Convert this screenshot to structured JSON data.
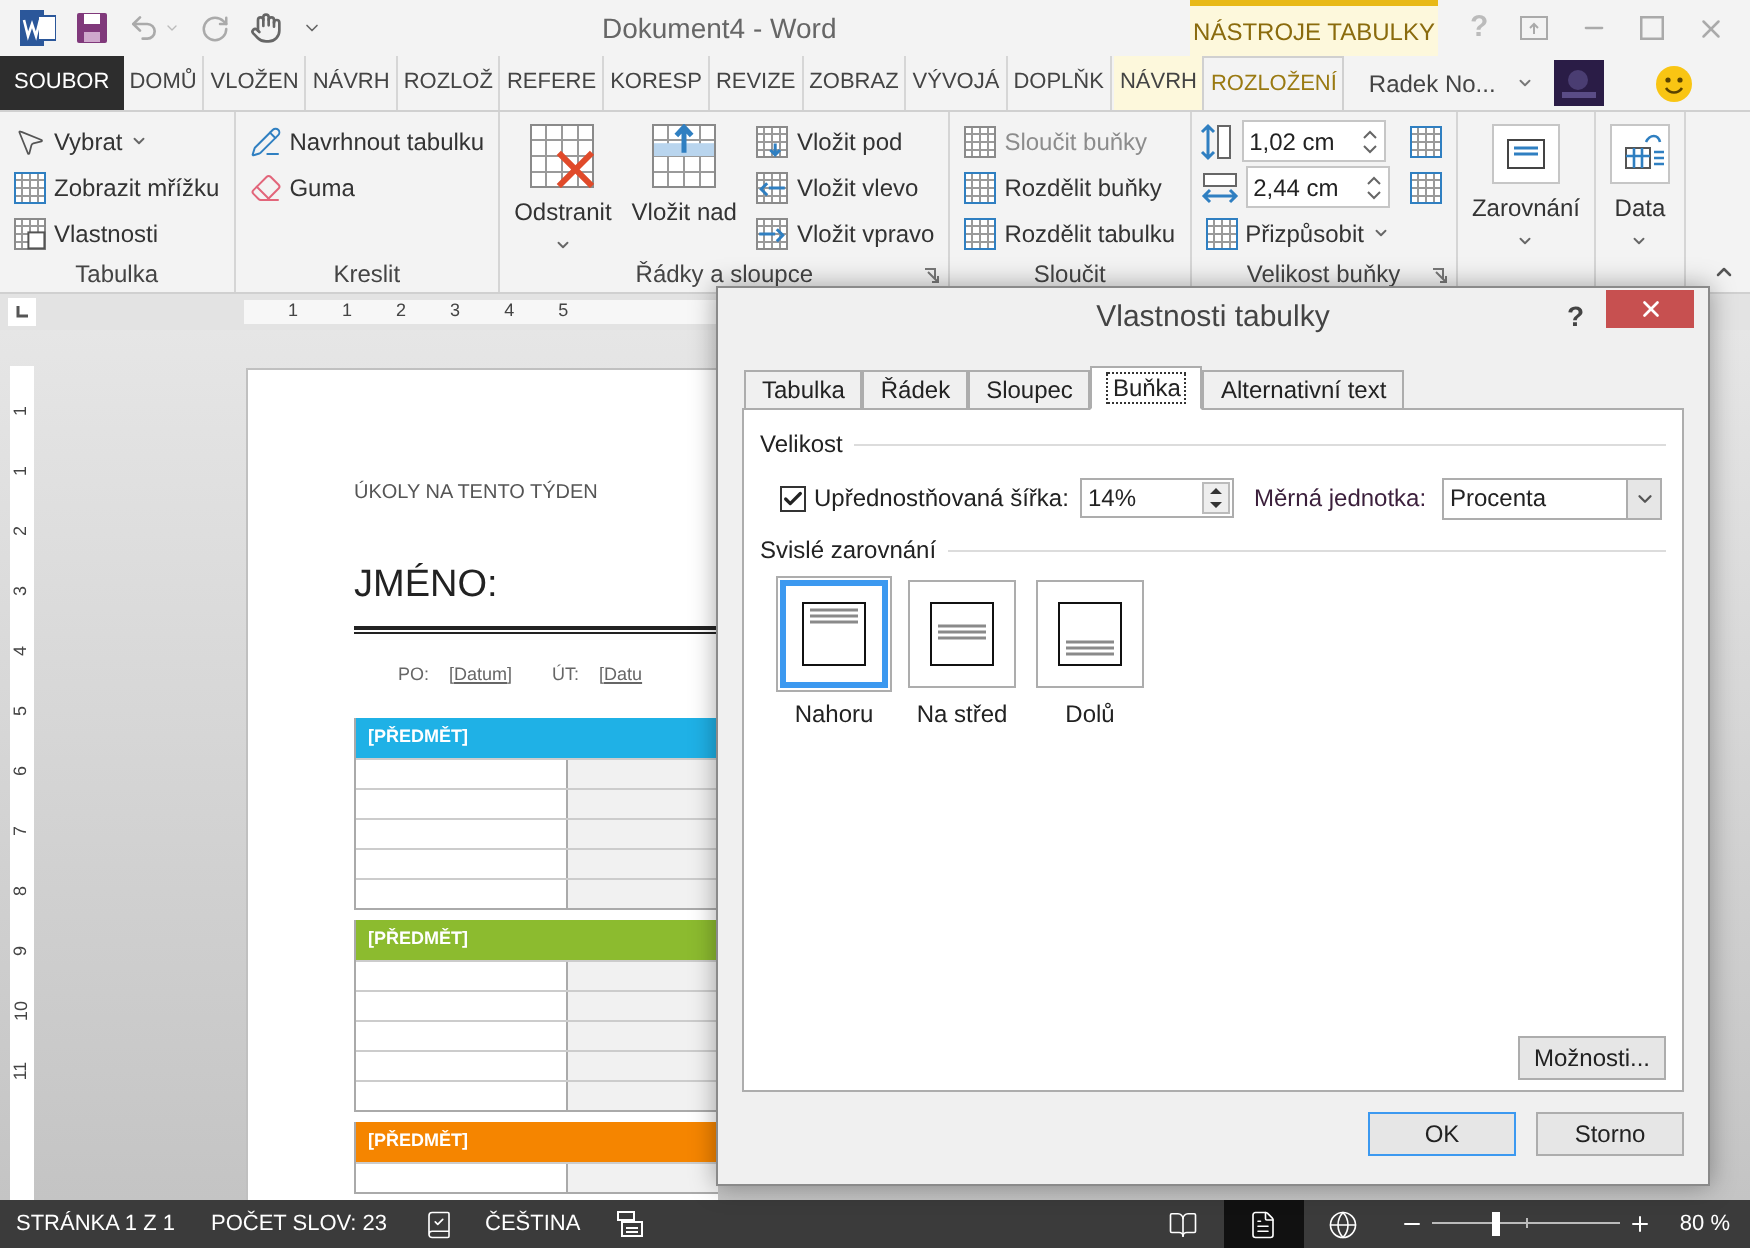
{
  "title_bar": {
    "title": "Dokument4 - Word",
    "contextual_label": "NÁSTROJE TABULKY",
    "help_glyph": "?"
  },
  "ribbon_tabs": [
    {
      "label": "SOUBOR",
      "kind": "file",
      "selected": false
    },
    {
      "label": "DOMŮ",
      "kind": "tab",
      "selected": false
    },
    {
      "label": "VLOŽEN",
      "kind": "tab",
      "selected": false
    },
    {
      "label": "NÁVRH",
      "kind": "tab",
      "selected": false
    },
    {
      "label": "ROZLOŽ",
      "kind": "tab",
      "selected": false
    },
    {
      "label": "REFERE",
      "kind": "tab",
      "selected": false
    },
    {
      "label": "KORESP",
      "kind": "tab",
      "selected": false
    },
    {
      "label": "REVIZE",
      "kind": "tab",
      "selected": false
    },
    {
      "label": "ZOBRAZ",
      "kind": "tab",
      "selected": false
    },
    {
      "label": "VÝVOJÁ",
      "kind": "tab",
      "selected": false
    },
    {
      "label": "DOPLŇK",
      "kind": "tab",
      "selected": false
    },
    {
      "label": "NÁVRH",
      "kind": "contextual",
      "selected": false
    },
    {
      "label": "ROZLOŽENÍ",
      "kind": "contextual",
      "selected": true
    }
  ],
  "account": {
    "name": "Radek No..."
  },
  "ribbon_groups": [
    {
      "label": "Tabulka",
      "items": [
        {
          "kind": "small",
          "label": "Vybrat",
          "dropdown": true,
          "disabled": false
        },
        {
          "kind": "small",
          "label": "Zobrazit mřížku",
          "dropdown": false,
          "disabled": false
        },
        {
          "kind": "small",
          "label": "Vlastnosti",
          "dropdown": false,
          "disabled": false
        }
      ]
    },
    {
      "label": "Kreslit",
      "items": [
        {
          "kind": "small",
          "label": "Navrhnout tabulku",
          "dropdown": false,
          "disabled": false
        },
        {
          "kind": "small",
          "label": "Guma",
          "dropdown": false,
          "disabled": false
        }
      ]
    },
    {
      "label": "Řádky a sloupce",
      "launcher": true,
      "items": [
        {
          "kind": "large",
          "label": "Odstranit",
          "dropdown": true,
          "disabled": false
        },
        {
          "kind": "large",
          "label": "Vložit nad",
          "dropdown": false,
          "disabled": false
        },
        {
          "kind": "small",
          "label": "Vložit pod",
          "dropdown": false,
          "disabled": false
        },
        {
          "kind": "small",
          "label": "Vložit vlevo",
          "dropdown": false,
          "disabled": false
        },
        {
          "kind": "small",
          "label": "Vložit vpravo",
          "dropdown": false,
          "disabled": false
        }
      ]
    },
    {
      "label": "Sloučit",
      "items": [
        {
          "kind": "small",
          "label": "Sloučit buňky",
          "dropdown": false,
          "disabled": true
        },
        {
          "kind": "small",
          "label": "Rozdělit buňky",
          "dropdown": false,
          "disabled": false
        },
        {
          "kind": "small",
          "label": "Rozdělit tabulku",
          "dropdown": false,
          "disabled": false
        }
      ]
    },
    {
      "label": "Velikost buňky",
      "launcher": true,
      "items": [
        {
          "kind": "spin",
          "value": "1,02 cm"
        },
        {
          "kind": "spin",
          "value": "2,44 cm"
        },
        {
          "kind": "small",
          "label": "Přizpůsobit",
          "dropdown": true,
          "disabled": false
        },
        {
          "kind": "icon"
        },
        {
          "kind": "icon"
        }
      ]
    },
    {
      "items": [
        {
          "kind": "large",
          "label": "Zarovnání",
          "dropdown": true,
          "disabled": false
        }
      ]
    },
    {
      "items": [
        {
          "kind": "large",
          "label": "Data",
          "dropdown": true,
          "disabled": false
        }
      ]
    }
  ],
  "rulers": {
    "horizontal": [
      "1",
      "1",
      "2",
      "3",
      "4",
      "5"
    ],
    "vertical": [
      "1",
      "1",
      "2",
      "3",
      "4",
      "5",
      "6",
      "7",
      "8",
      "9",
      "10",
      "11"
    ]
  },
  "document": {
    "heading": "ÚKOLY NA TENTO TÝDEN",
    "name_label": "JMÉNO:",
    "days": [
      {
        "label": "PO:",
        "date": "[Datum]"
      },
      {
        "label": "ÚT:",
        "date": "[Datu"
      }
    ],
    "subjects": [
      {
        "title": "[PŘEDMĚT]",
        "color": "#1fb1e6"
      },
      {
        "title": "[PŘEDMĚT]",
        "color": "#8cbb2f"
      },
      {
        "title": "[PŘEDMĚT]",
        "color": "#f58500"
      }
    ]
  },
  "dialog": {
    "title": "Vlastnosti tabulky",
    "help_glyph": "?",
    "tabs": [
      {
        "label": "Tabulka",
        "selected": false
      },
      {
        "label": "Řádek",
        "selected": false
      },
      {
        "label": "Sloupec",
        "selected": false
      },
      {
        "label": "Buňka",
        "selected": true
      },
      {
        "label": "Alternativní text",
        "selected": false
      }
    ],
    "size_section": "Velikost",
    "preferred_width": {
      "label": "Upřednostňovaná šířka:",
      "checked": true,
      "value": "14%"
    },
    "unit": {
      "label": "Měrná jednotka:",
      "value": "Procenta"
    },
    "valign_section": "Svislé zarovnání",
    "valign_options": [
      {
        "label": "Nahoru",
        "kind": "top",
        "selected": true
      },
      {
        "label": "Na střed",
        "kind": "middle",
        "selected": false
      },
      {
        "label": "Dolů",
        "kind": "bottom",
        "selected": false
      }
    ],
    "options_button": "Možnosti...",
    "buttons": [
      {
        "label": "OK",
        "default": true
      },
      {
        "label": "Storno",
        "default": false
      }
    ]
  },
  "status_bar": {
    "items": [
      "STRÁNKA 1 Z 1",
      "POČET SLOV: 23",
      "ČEŠTINA"
    ],
    "views": [
      {
        "kind": "read",
        "selected": false
      },
      {
        "kind": "print",
        "selected": true
      },
      {
        "kind": "web",
        "selected": false
      }
    ],
    "zoom": {
      "level": 0.34,
      "reading": "80 %"
    }
  }
}
